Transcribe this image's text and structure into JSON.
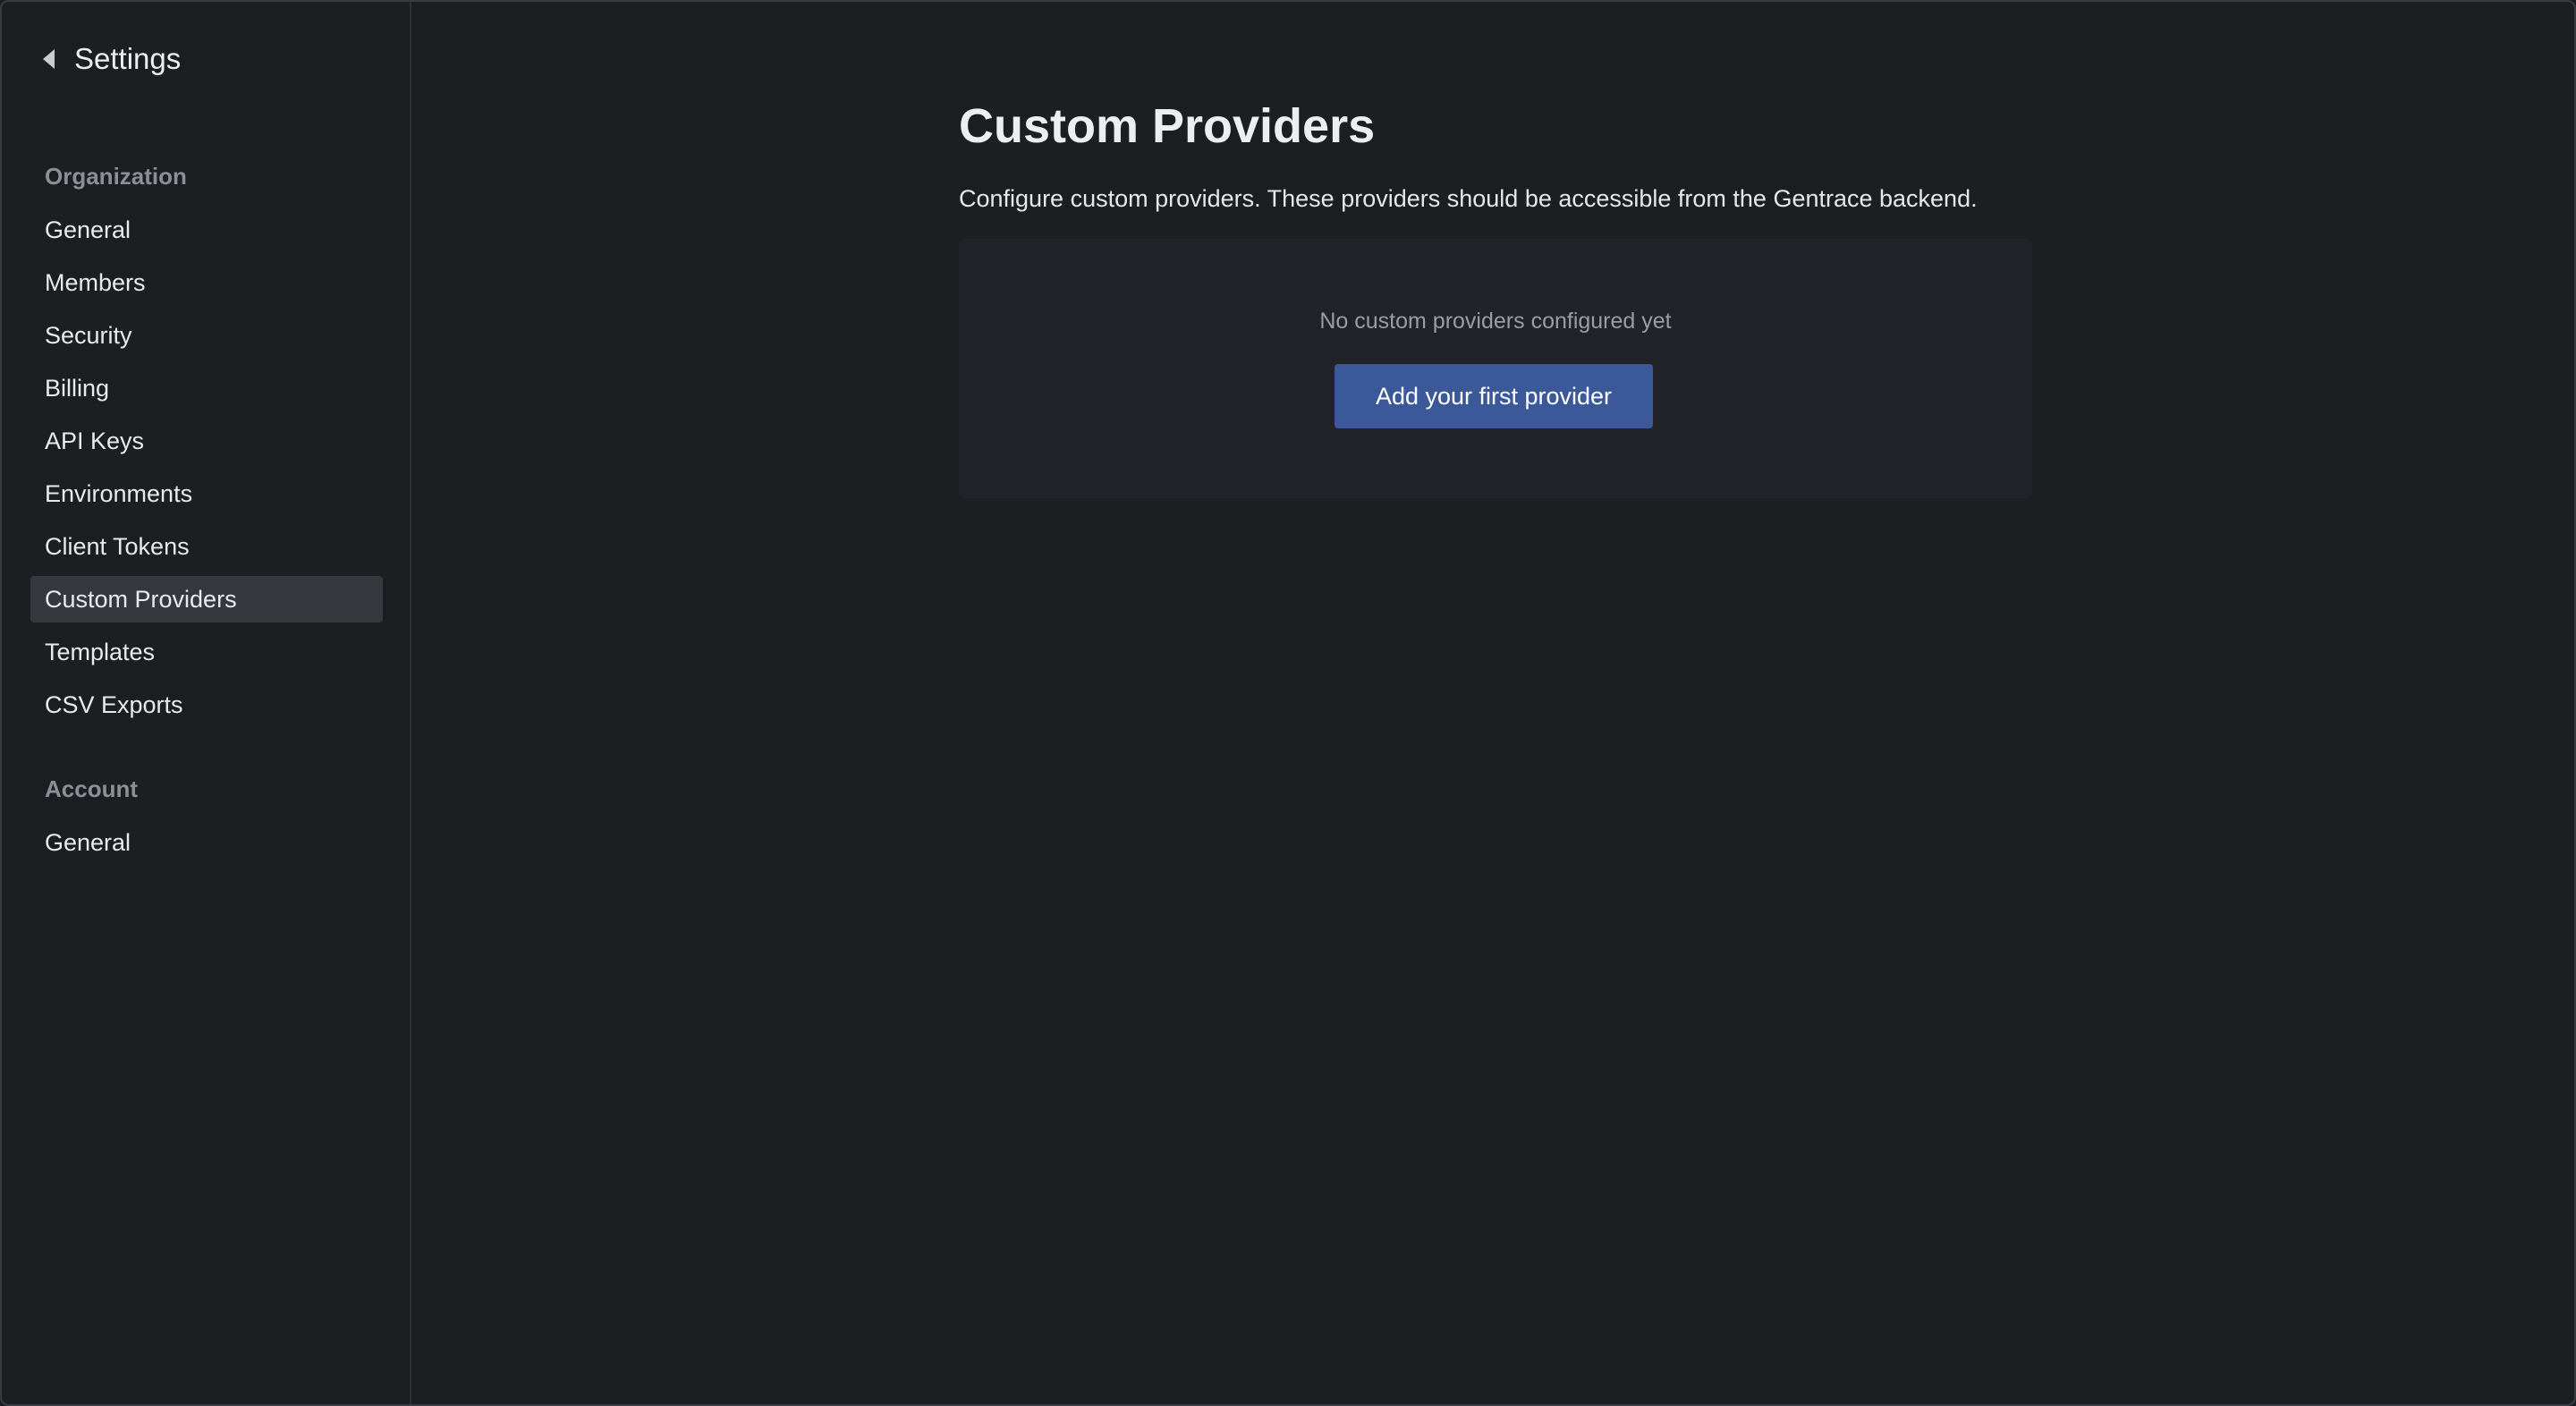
{
  "header": {
    "back_label": "Settings"
  },
  "sidebar": {
    "sections": [
      {
        "label": "Organization",
        "items": [
          {
            "label": "General",
            "active": false
          },
          {
            "label": "Members",
            "active": false
          },
          {
            "label": "Security",
            "active": false
          },
          {
            "label": "Billing",
            "active": false
          },
          {
            "label": "API Keys",
            "active": false
          },
          {
            "label": "Environments",
            "active": false
          },
          {
            "label": "Client Tokens",
            "active": false
          },
          {
            "label": "Custom Providers",
            "active": true
          },
          {
            "label": "Templates",
            "active": false
          },
          {
            "label": "CSV Exports",
            "active": false
          }
        ]
      },
      {
        "label": "Account",
        "items": [
          {
            "label": "General",
            "active": false
          }
        ]
      }
    ]
  },
  "main": {
    "title": "Custom Providers",
    "description": "Configure custom providers. These providers should be accessible from the Gentrace backend.",
    "empty_state": {
      "message": "No custom providers configured yet",
      "button_label": "Add your first provider"
    }
  },
  "colors": {
    "background": "#1d1e22",
    "card": "#222328",
    "accent": "#3b5998",
    "active_nav": "#36383d"
  },
  "icons": {
    "back": "caret-left-icon"
  }
}
